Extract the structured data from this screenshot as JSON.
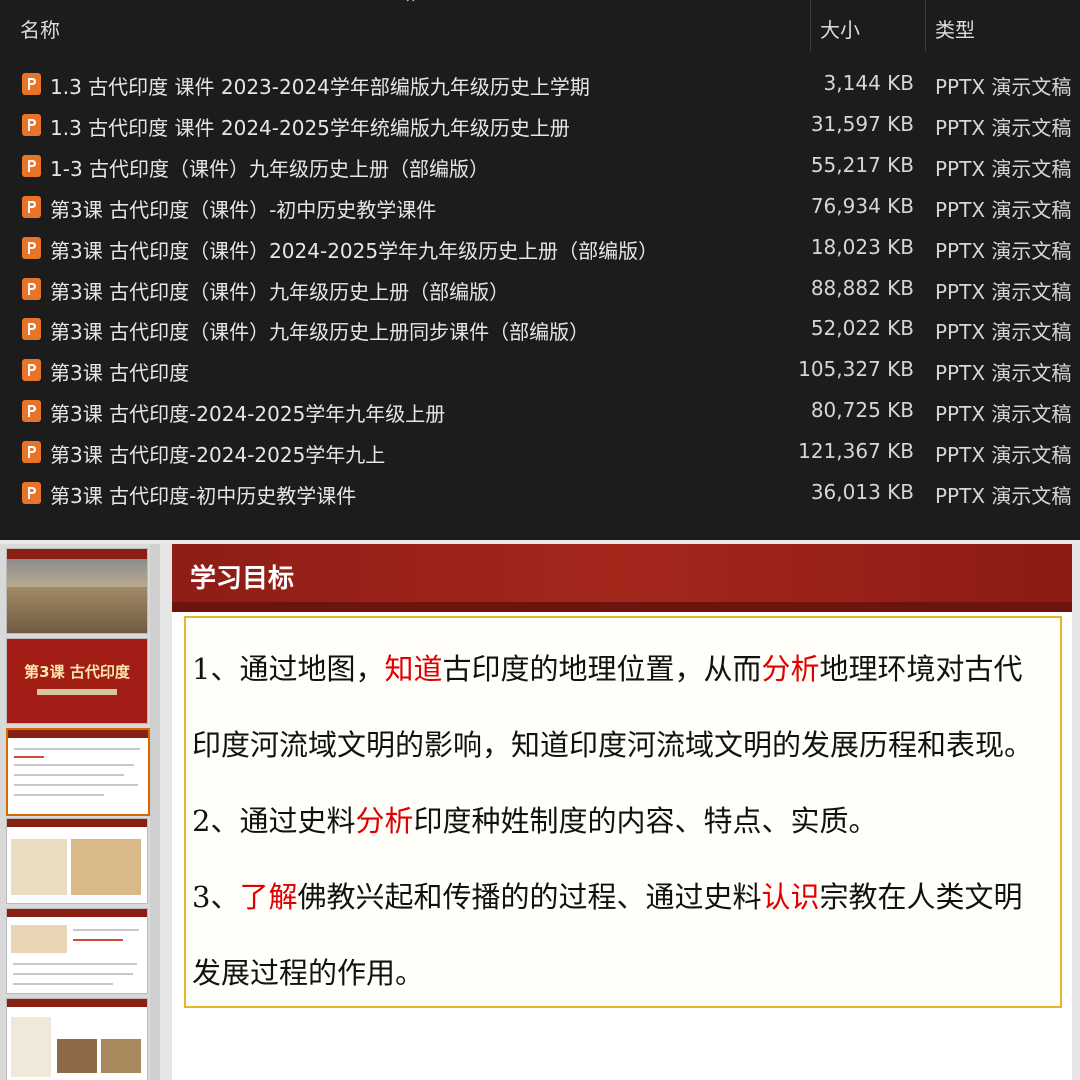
{
  "file_list": {
    "columns": {
      "name": "名称",
      "size": "大小",
      "type": "类型"
    },
    "rows": [
      {
        "name": "1.3 古代印度 课件 2023-2024学年部编版九年级历史上学期",
        "size": "3,144 KB",
        "type": "PPTX 演示文稿"
      },
      {
        "name": "1.3 古代印度 课件 2024-2025学年统编版九年级历史上册",
        "size": "31,597 KB",
        "type": "PPTX 演示文稿"
      },
      {
        "name": "1-3 古代印度（课件）九年级历史上册（部编版）",
        "size": "55,217 KB",
        "type": "PPTX 演示文稿"
      },
      {
        "name": "第3课  古代印度（课件）-初中历史教学课件",
        "size": "76,934 KB",
        "type": "PPTX 演示文稿"
      },
      {
        "name": "第3课 古代印度（课件）2024-2025学年九年级历史上册（部编版）",
        "size": "18,023 KB",
        "type": "PPTX 演示文稿"
      },
      {
        "name": "第3课 古代印度（课件）九年级历史上册（部编版）",
        "size": "88,882 KB",
        "type": "PPTX 演示文稿"
      },
      {
        "name": "第3课 古代印度（课件）九年级历史上册同步课件（部编版）",
        "size": "52,022 KB",
        "type": "PPTX 演示文稿"
      },
      {
        "name": "第3课 古代印度",
        "size": "105,327 KB",
        "type": "PPTX 演示文稿"
      },
      {
        "name": "第3课 古代印度-2024-2025学年九年级上册",
        "size": "80,725 KB",
        "type": "PPTX 演示文稿"
      },
      {
        "name": "第3课 古代印度-2024-2025学年九上",
        "size": "121,367 KB",
        "type": "PPTX 演示文稿"
      },
      {
        "name": "第3课 古代印度-初中历史教学课件",
        "size": "36,013 KB",
        "type": "PPTX 演示文稿"
      }
    ],
    "icon": "pptx-file-icon",
    "icon_color": "#e8742a"
  },
  "thumbnails": {
    "slide2_title": "第3课 古代印度"
  },
  "slide": {
    "title": "学习目标",
    "lines": [
      [
        {
          "t": "1、通过地图，"
        },
        {
          "t": "知道",
          "hl": true
        },
        {
          "t": "古印度的地理位置，从而"
        },
        {
          "t": "分析",
          "hl": true
        },
        {
          "t": "地理环境对古代"
        }
      ],
      [
        {
          "t": "印度河流域文明的影响，知道印度河流域文明的发展历程和表现。"
        }
      ],
      [
        {
          "t": "2、通过史料"
        },
        {
          "t": "分析",
          "hl": true
        },
        {
          "t": "印度种姓制度的内容、特点、实质。"
        }
      ],
      [
        {
          "t": "3、"
        },
        {
          "t": "了解",
          "hl": true
        },
        {
          "t": "佛教兴起和传播的的过程、通过史料"
        },
        {
          "t": "认识",
          "hl": true
        },
        {
          "t": "宗教在人类文明"
        }
      ],
      [
        {
          "t": "发展过程的作用。"
        }
      ]
    ],
    "header_color": "#9a2219",
    "highlight_color": "#e00000",
    "border_color": "#e3b52a"
  }
}
